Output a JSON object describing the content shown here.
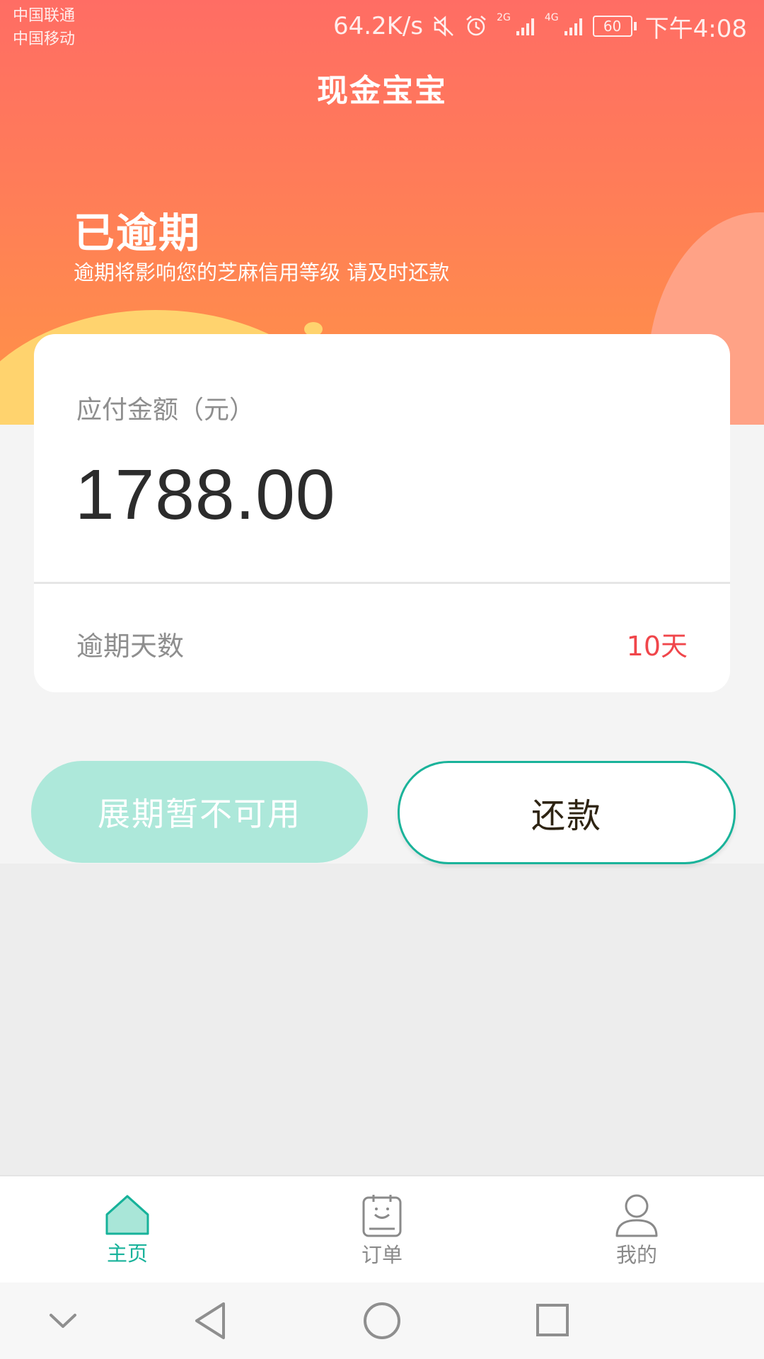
{
  "status_bar": {
    "carrier_1": "中国联通",
    "carrier_2": "中国移动",
    "net_speed": "64.2K/s",
    "net_2g": "2G",
    "net_4g": "4G",
    "battery": "60",
    "time": "下午4:08",
    "icons": [
      "mute-icon",
      "alarm-icon",
      "signal-icon",
      "battery-icon"
    ]
  },
  "header": {
    "app_title": "现金宝宝",
    "status_title": "已逾期",
    "status_subtitle": "逾期将影响您的芝麻信用等级 请及时还款"
  },
  "card": {
    "amount_label": "应付金额（元）",
    "amount_value": "1788.00",
    "overdue_days_label": "逾期天数",
    "overdue_days_value": "10天"
  },
  "actions": {
    "extend_label": "展期暂不可用",
    "repay_label": "还款"
  },
  "bottom_nav": {
    "items": [
      {
        "label": "主页",
        "icon": "home-icon",
        "active": true
      },
      {
        "label": "订单",
        "icon": "order-icon",
        "active": false
      },
      {
        "label": "我的",
        "icon": "profile-icon",
        "active": false
      }
    ]
  },
  "system_nav": {
    "icons": [
      "chevron-down-icon",
      "back-icon",
      "home-circle-icon",
      "recents-icon"
    ]
  },
  "colors": {
    "header_gradient_top": "#ff6d64",
    "header_gradient_bottom": "#ff9446",
    "accent": "#17b29a",
    "disabled_button": "#ade8da",
    "overdue_red": "#f0464b"
  }
}
